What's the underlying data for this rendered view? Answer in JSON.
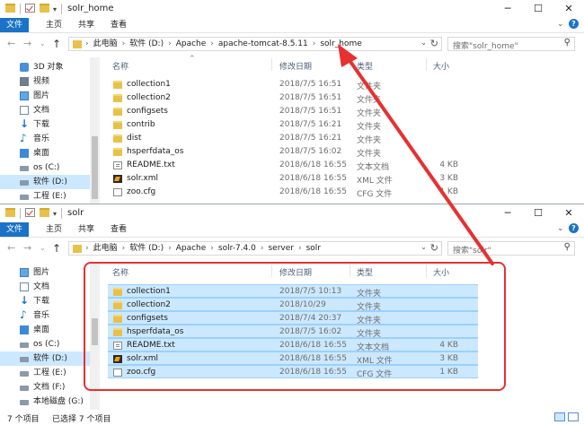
{
  "window1": {
    "title": "solr_home",
    "ribbon_tabs": [
      "文件",
      "主页",
      "共享",
      "查看"
    ],
    "address": [
      "此电脑",
      "软件 (D:)",
      "Apache",
      "apache-tomcat-8.5.11",
      "solr_home"
    ],
    "search_placeholder": "搜索\"solr_home\"",
    "nav_items": [
      {
        "label": "3D 对象",
        "icon": "cube-icon"
      },
      {
        "label": "视频",
        "icon": "video-icon"
      },
      {
        "label": "图片",
        "icon": "picture-icon"
      },
      {
        "label": "文档",
        "icon": "document-icon"
      },
      {
        "label": "下载",
        "icon": "download-icon"
      },
      {
        "label": "音乐",
        "icon": "music-icon"
      },
      {
        "label": "桌面",
        "icon": "desktop-icon"
      },
      {
        "label": "os (C:)",
        "icon": "drive-icon"
      },
      {
        "label": "软件 (D:)",
        "icon": "drive-icon"
      },
      {
        "label": "工程 (E:)",
        "icon": "drive-icon"
      }
    ],
    "columns": {
      "name": "名称",
      "date": "修改日期",
      "type": "类型",
      "size": "大小"
    },
    "files": [
      {
        "name": "collection1",
        "date": "2018/7/5 16:51",
        "type": "文件夹",
        "size": "",
        "icon": "folder-icon"
      },
      {
        "name": "collection2",
        "date": "2018/7/5 16:51",
        "type": "文件夹",
        "size": "",
        "icon": "folder-icon"
      },
      {
        "name": "configsets",
        "date": "2018/7/5 16:51",
        "type": "文件夹",
        "size": "",
        "icon": "folder-icon"
      },
      {
        "name": "contrib",
        "date": "2018/7/5 16:21",
        "type": "文件夹",
        "size": "",
        "icon": "folder-icon"
      },
      {
        "name": "dist",
        "date": "2018/7/5 16:21",
        "type": "文件夹",
        "size": "",
        "icon": "folder-icon"
      },
      {
        "name": "hsperfdata_os",
        "date": "2018/7/5 16:02",
        "type": "文件夹",
        "size": "",
        "icon": "folder-icon"
      },
      {
        "name": "README.txt",
        "date": "2018/6/18 16:55",
        "type": "文本文档",
        "size": "4 KB",
        "icon": "text-file-icon"
      },
      {
        "name": "solr.xml",
        "date": "2018/6/18 16:55",
        "type": "XML 文件",
        "size": "3 KB",
        "icon": "xml-file-icon"
      },
      {
        "name": "zoo.cfg",
        "date": "2018/6/18 16:55",
        "type": "CFG 文件",
        "size": "1 KB",
        "icon": "cfg-file-icon"
      }
    ]
  },
  "window2": {
    "title": "solr",
    "ribbon_tabs": [
      "文件",
      "主页",
      "共享",
      "查看"
    ],
    "address": [
      "此电脑",
      "软件 (D:)",
      "Apache",
      "solr-7.4.0",
      "server",
      "solr"
    ],
    "search_placeholder": "搜索\"solr\"",
    "nav_items": [
      {
        "label": "图片",
        "icon": "picture-icon"
      },
      {
        "label": "文档",
        "icon": "document-icon"
      },
      {
        "label": "下载",
        "icon": "download-icon"
      },
      {
        "label": "音乐",
        "icon": "music-icon"
      },
      {
        "label": "桌面",
        "icon": "desktop-icon"
      },
      {
        "label": "os (C:)",
        "icon": "drive-icon"
      },
      {
        "label": "软件 (D:)",
        "icon": "drive-icon"
      },
      {
        "label": "工程 (E:)",
        "icon": "drive-icon"
      },
      {
        "label": "文档 (F:)",
        "icon": "drive-icon"
      },
      {
        "label": "本地磁盘 (G:)",
        "icon": "drive-icon"
      }
    ],
    "columns": {
      "name": "名称",
      "date": "修改日期",
      "type": "类型",
      "size": "大小"
    },
    "files": [
      {
        "name": "collection1",
        "date": "2018/7/5 10:13",
        "type": "文件夹",
        "size": "",
        "icon": "folder-icon"
      },
      {
        "name": "collection2",
        "date": "2018/10/29",
        "type": "文件夹",
        "size": "",
        "icon": "folder-icon"
      },
      {
        "name": "configsets",
        "date": "2018/7/4 20:37",
        "type": "文件夹",
        "size": "",
        "icon": "folder-icon"
      },
      {
        "name": "hsperfdata_os",
        "date": "2018/7/5 16:02",
        "type": "文件夹",
        "size": "",
        "icon": "folder-icon"
      },
      {
        "name": "README.txt",
        "date": "2018/6/18 16:55",
        "type": "文本文档",
        "size": "4 KB",
        "icon": "text-file-icon"
      },
      {
        "name": "solr.xml",
        "date": "2018/6/18 16:55",
        "type": "XML 文件",
        "size": "3 KB",
        "icon": "xml-file-icon"
      },
      {
        "name": "zoo.cfg",
        "date": "2018/6/18 16:55",
        "type": "CFG 文件",
        "size": "1 KB",
        "icon": "cfg-file-icon"
      }
    ],
    "status": {
      "count": "7 个项目",
      "selected": "已选择 7 个项目"
    }
  },
  "annotation_color": "#e63131",
  "selection_color": "#cce8ff",
  "ribbon_file_color": "#1a73c8"
}
